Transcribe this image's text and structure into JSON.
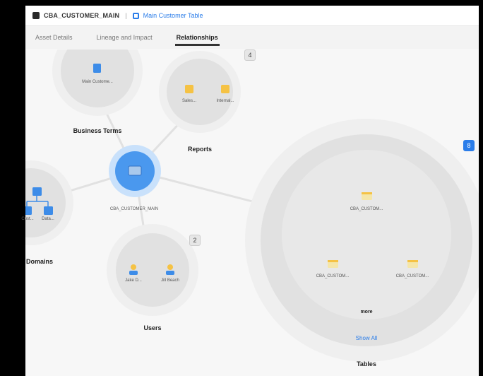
{
  "header": {
    "asset_name": "CBA_CUSTOMER_MAIN",
    "database_link": "Main Customer Table"
  },
  "tabs": [
    "Asset Details",
    "Lineage and Impact",
    "Relationships"
  ],
  "center_node": {
    "label": "CBA_CUSTOMER_MAIN"
  },
  "groups": {
    "business_terms": {
      "title": "Business Terms",
      "items": [
        "Main Custome..."
      ]
    },
    "reports": {
      "title": "Reports",
      "items": [
        "Sales...",
        "Internal..."
      ]
    },
    "domains": {
      "title": "Domains",
      "items": [
        "",
        "Cust...",
        "Data..."
      ]
    },
    "users": {
      "title": "Users",
      "items": [
        "Jake D...",
        "Jill Beach"
      ]
    },
    "tables": {
      "title": "Tables",
      "items": [
        "CBA_CUSTOM...",
        "CBA_CUSTOM...",
        "CBA_CUSTOM..."
      ],
      "more": "more",
      "show_all": "Show All"
    }
  },
  "badges": {
    "reports": "4",
    "users": "2",
    "tables": "8"
  }
}
